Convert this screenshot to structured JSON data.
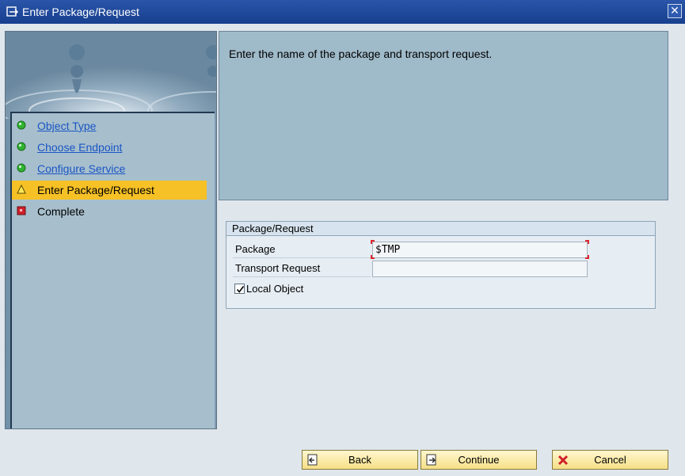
{
  "window": {
    "title": "Enter Package/Request",
    "close_glyph": "✕"
  },
  "steps": [
    {
      "label": "Object Type",
      "status": "done",
      "link": true
    },
    {
      "label": "Choose Endpoint",
      "status": "done",
      "link": true
    },
    {
      "label": "Configure Service",
      "status": "done",
      "link": true
    },
    {
      "label": "Enter Package/Request",
      "status": "current",
      "link": false
    },
    {
      "label": "Complete",
      "status": "pending",
      "link": false
    }
  ],
  "description": "Enter the name of the package and transport request.",
  "group": {
    "title": "Package/Request",
    "package_label": "Package",
    "package_value": "$TMP",
    "transport_label": "Transport Request",
    "transport_value": "",
    "local_object_label": "Local Object",
    "local_object_checked": true
  },
  "buttons": {
    "back": "Back",
    "continue": "Continue",
    "cancel": "Cancel"
  },
  "colors": {
    "titlebar": "#1f4a9c",
    "current_step": "#f6c126",
    "link": "#1a55c4",
    "done_icon": "#2fb32f",
    "pending_icon": "#d0202a",
    "required_marker": "#e0262e"
  },
  "icons": {
    "window": "window-menu-icon",
    "done": "green-dot-icon",
    "current": "warning-triangle-icon",
    "pending": "red-square-icon",
    "back": "back-arrow-icon",
    "continue": "continue-arrow-icon",
    "cancel": "cancel-x-icon"
  }
}
